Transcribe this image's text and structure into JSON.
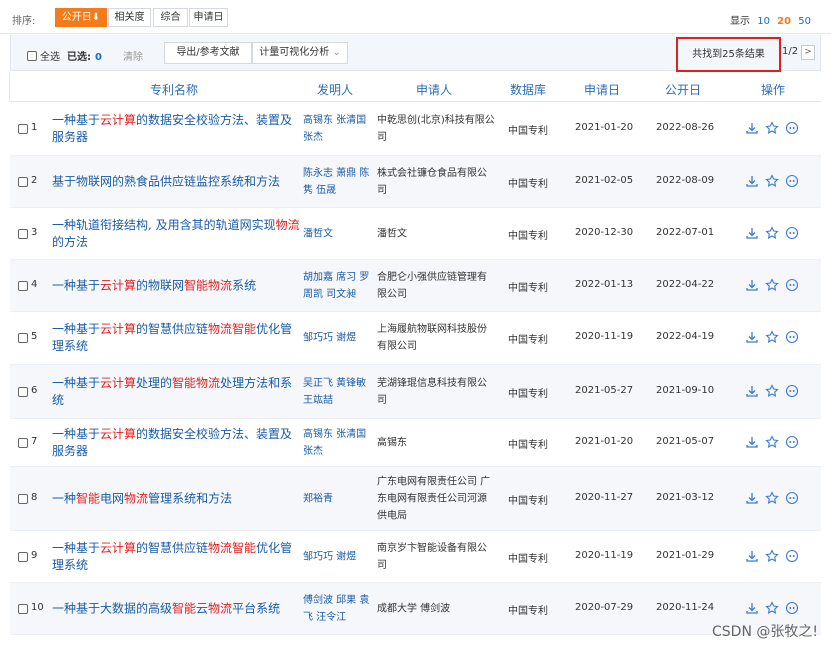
{
  "sort": {
    "label": "排序:",
    "options": [
      "公开日⬇",
      "相关度",
      "综合",
      "申请日"
    ],
    "active": 0
  },
  "display": {
    "label": "显示",
    "options": [
      "10",
      "20",
      "50"
    ],
    "active": 1
  },
  "toolbar": {
    "select_all": "全选",
    "selected_label": "已选:",
    "selected_count": "0",
    "clear": "清除",
    "export": "导出/参考文献",
    "analysis": "计量可视化分析",
    "analysis_caret": "⌄",
    "total": "共找到25条结果",
    "page": "1/2",
    "next": ">"
  },
  "columns": [
    "专利名称",
    "发明人",
    "申请人",
    "数据库",
    "申请日",
    "公开日",
    "操作"
  ],
  "rows": [
    {
      "num": "1",
      "title": [
        [
          "一种基于",
          ""
        ],
        [
          "云计算",
          "hl"
        ],
        [
          "的数据安全校验方法、装置及服务器",
          ""
        ]
      ],
      "inventors": "高锡东 张清国 张杰",
      "applicant": "中乾思创(北京)科技有限公司",
      "db": "中国专利",
      "apply_date": "2021-01-20",
      "pub_date": "2022-08-26"
    },
    {
      "num": "2",
      "title": [
        [
          "基于物联网的熟食品供应链监控系统和方法",
          ""
        ]
      ],
      "inventors": "陈永志 萧鼎 陈隽 伍晟",
      "applicant": "株式会社镰仓食品有限公司",
      "db": "中国专利",
      "apply_date": "2021-02-05",
      "pub_date": "2022-08-09"
    },
    {
      "num": "3",
      "title": [
        [
          "一种轨道衔接结构, 及用含其的轨道网实现",
          ""
        ],
        [
          "物流",
          "hl"
        ],
        [
          "的方法",
          ""
        ]
      ],
      "inventors": "潘哲文",
      "applicant": "潘哲文",
      "db": "中国专利",
      "apply_date": "2020-12-30",
      "pub_date": "2022-07-01"
    },
    {
      "num": "4",
      "title": [
        [
          "一种基于",
          ""
        ],
        [
          "云计算",
          "hl"
        ],
        [
          "的物联网",
          ""
        ],
        [
          "智能物流",
          "hl"
        ],
        [
          "系统",
          ""
        ]
      ],
      "inventors": "胡加嘉 席习 罗周凯 司文昶",
      "applicant": "合肥仑小强供应链管理有限公司",
      "db": "中国专利",
      "apply_date": "2022-01-13",
      "pub_date": "2022-04-22"
    },
    {
      "num": "5",
      "title": [
        [
          "一种基于",
          ""
        ],
        [
          "云计算",
          "hl"
        ],
        [
          "的智慧供应链",
          ""
        ],
        [
          "物流智能",
          "hl"
        ],
        [
          "优化管理系统",
          ""
        ]
      ],
      "inventors": "邹巧巧 谢煜",
      "applicant": "上海履航物联网科技股份有限公司",
      "db": "中国专利",
      "apply_date": "2020-11-19",
      "pub_date": "2022-04-19"
    },
    {
      "num": "6",
      "title": [
        [
          "一种基于",
          ""
        ],
        [
          "云计算",
          "hl"
        ],
        [
          "处理的",
          ""
        ],
        [
          "智能物流",
          "hl"
        ],
        [
          "处理方法和系统",
          ""
        ]
      ],
      "inventors": "吴正飞 黄锋敏 王竑喆",
      "applicant": "芜湖锋琨信息科技有限公司",
      "db": "中国专利",
      "apply_date": "2021-05-27",
      "pub_date": "2021-09-10"
    },
    {
      "num": "7",
      "title": [
        [
          "一种基于",
          ""
        ],
        [
          "云计算",
          "hl"
        ],
        [
          "的数据安全校验方法、装置及服务器",
          ""
        ]
      ],
      "inventors": "高锡东 张清国 张杰",
      "applicant": "高锡东",
      "db": "中国专利",
      "apply_date": "2021-01-20",
      "pub_date": "2021-05-07"
    },
    {
      "num": "8",
      "title": [
        [
          "一种",
          ""
        ],
        [
          "智能",
          "hl"
        ],
        [
          "电网",
          ""
        ],
        [
          "物流",
          "hl"
        ],
        [
          "管理系统和方法",
          ""
        ]
      ],
      "inventors": "郑裕青",
      "applicant": "广东电网有限责任公司 广东电网有限责任公司河源供电局",
      "db": "中国专利",
      "apply_date": "2020-11-27",
      "pub_date": "2021-03-12"
    },
    {
      "num": "9",
      "title": [
        [
          "一种基于",
          ""
        ],
        [
          "云计算",
          "hl"
        ],
        [
          "的智慧供应链",
          ""
        ],
        [
          "物流智能",
          "hl"
        ],
        [
          "优化管理系统",
          ""
        ]
      ],
      "inventors": "邹巧巧 谢煜",
      "applicant": "南京岁卞智能设备有限公司",
      "db": "中国专利",
      "apply_date": "2020-11-19",
      "pub_date": "2021-01-29"
    },
    {
      "num": "10",
      "title": [
        [
          "一种基于大数据的高级",
          ""
        ],
        [
          "智能",
          "hl"
        ],
        [
          "云",
          ""
        ],
        [
          "物流",
          "hl"
        ],
        [
          "平台系统",
          ""
        ]
      ],
      "inventors": "傅剑波 邱果 袁飞 汪令江",
      "applicant": "成都大学 傅剑波",
      "db": "中国专利",
      "apply_date": "2020-07-29",
      "pub_date": "2020-11-24"
    }
  ],
  "icons": [
    "download-icon",
    "favorite-star-icon",
    "quote-icon"
  ],
  "colors": {
    "accent": "#f57a1a",
    "link": "#1a5ba8",
    "highlight": "#e02020",
    "header": "#2c6fb7",
    "row_alt": "#f5f7fa"
  },
  "watermark": "CSDN @张牧之!"
}
